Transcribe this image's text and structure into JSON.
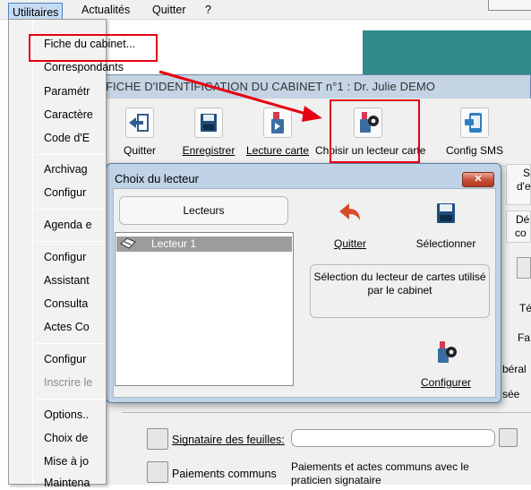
{
  "menubar": {
    "items": [
      "Utilitaires",
      "Actualités",
      "Quitter",
      "?"
    ]
  },
  "dropdown": {
    "items": [
      {
        "label": "Fiche du cabinet..."
      },
      {
        "label": "Correspondants"
      },
      {
        "label": "Paramétr"
      },
      {
        "label": "Caractère"
      },
      {
        "label": "Code d'E"
      },
      {
        "label": "Archivag"
      },
      {
        "label": "Configur"
      },
      {
        "label": "Agenda e"
      },
      {
        "label": "Configur"
      },
      {
        "label": "Assistant"
      },
      {
        "label": "Consulta"
      },
      {
        "label": "Actes Co"
      },
      {
        "label": "Configur"
      },
      {
        "label": "Inscrire le"
      },
      {
        "label": "Options.."
      },
      {
        "label": "Choix de"
      },
      {
        "label": "Mise à jo"
      },
      {
        "label": "Maintena"
      }
    ]
  },
  "fiche": {
    "title": "FICHE D'IDENTIFICATION DU CABINET n°1 : Dr. Julie DEMO",
    "toolbar": {
      "quitter": "Quitter",
      "enregistrer": "Enregistrer",
      "lecture_carte": "Lecture carte",
      "choisir_lecteur": "Choisir un lecteur carte",
      "config_sms": "Config SMS"
    },
    "side_fragments": [
      "S",
      "d'e",
      "Dé",
      "co",
      "Té",
      "Fa",
      "béral",
      "sée"
    ],
    "signataire_label": "Signataire des feuilles:",
    "signataire_value": "",
    "paiements_label": "Paiements communs",
    "paiements_desc": "Paiements et actes communs avec le praticien signataire"
  },
  "dialog": {
    "title": "Choix du lecteur",
    "close_label": "✕",
    "list_header": "Lecteurs",
    "readers": [
      "Lecteur 1"
    ],
    "quitter": "Quitter",
    "selectionner": "Sélectionner",
    "info": "Sélection du lecteur de cartes utilisé par le cabinet",
    "configurer": "Configurer"
  },
  "colors": {
    "annotation": "#e60012",
    "teal_band": "#2f8a8c",
    "window_frame": "#c4d4e4"
  }
}
